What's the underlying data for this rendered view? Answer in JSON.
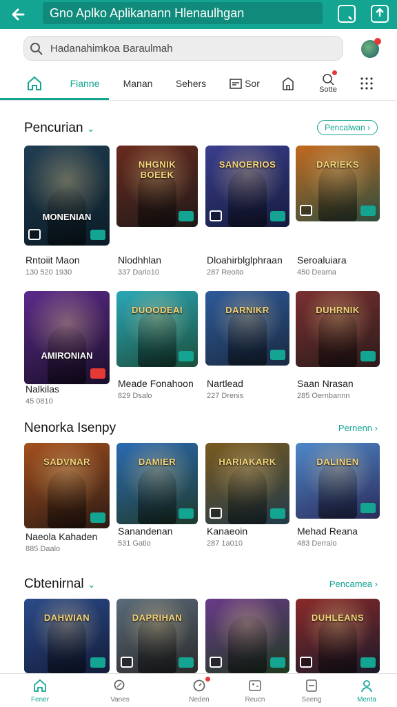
{
  "topbar": {
    "title": "Gno Aplko Aplikanann Hlenaulhgan",
    "back_icon": "arrow-left-icon",
    "icons": [
      "bookmark-icon",
      "share-icon"
    ]
  },
  "search": {
    "placeholder": "Hadanahimkoa Baraulmah"
  },
  "tabs": [
    {
      "label": ""
    },
    {
      "label": "Fianne"
    },
    {
      "label": "Manan"
    },
    {
      "label": "Sehers"
    },
    {
      "label": "Sor"
    },
    {
      "label": ""
    },
    {
      "label": "Sotte"
    },
    {
      "label": ""
    }
  ],
  "sections": [
    {
      "title": "Pencurian",
      "link": "Pencalwan"
    },
    {
      "title": "Nenorka Isenpy",
      "link": "Pernenn"
    },
    {
      "title": "Cbtenirnal",
      "link": "Pencamea"
    }
  ],
  "cards": [
    {
      "title": "Rntoiit Maon",
      "sub": "130 520 1930",
      "art": "MONENIAN",
      "colors": [
        "#1f3d52",
        "#0b1b26"
      ]
    },
    {
      "title": "Nlodhhlan",
      "sub": "337 Dario10",
      "art": "NHGNIK BOEEK",
      "colors": [
        "#6a2b1e",
        "#1f1a1a"
      ]
    },
    {
      "title": "Dloahirblglphraan",
      "sub": "287 Reoito",
      "art": "SANOERIOS",
      "colors": [
        "#3b3f8e",
        "#151b3d"
      ]
    },
    {
      "title": "Seroaluiara",
      "sub": "450 Deama",
      "art": "DARIEKS",
      "colors": [
        "#c26a1f",
        "#2e4d3f"
      ]
    },
    {
      "title": "Nalkilas",
      "sub": "45 0810",
      "art": "AMIRONIAN",
      "colors": [
        "#5b2a8a",
        "#1a0f2a"
      ]
    },
    {
      "title": "Meade Fonahoon",
      "sub": "829 Dsalo",
      "art": "DUOODEAI",
      "colors": [
        "#2aa7b8",
        "#1b4e3a"
      ]
    },
    {
      "title": "Nartlead",
      "sub": "227 Drenis",
      "art": "DARNIKR",
      "colors": [
        "#2e5b9b",
        "#1a2940"
      ]
    },
    {
      "title": "Saan Nrasan",
      "sub": "285 Oernbannn",
      "art": "DUHRNIK",
      "colors": [
        "#7a3030",
        "#2b1b1b"
      ]
    },
    {
      "title": "Naeola Kahaden",
      "sub": "885 Daalo",
      "art": "SADVNAR",
      "colors": [
        "#a5501e",
        "#2a1a14"
      ]
    },
    {
      "title": "Sanandenan",
      "sub": "531 Gatio",
      "art": "DAMIER",
      "colors": [
        "#2b6bb3",
        "#1f3a2a"
      ]
    },
    {
      "title": "Kanaeoin",
      "sub": "287 1a010",
      "art": "HARIAKARK",
      "colors": [
        "#7a5a1f",
        "#203a4a"
      ]
    },
    {
      "title": "Mehad Reana",
      "sub": "483 Derraio",
      "art": "DALINEN",
      "colors": [
        "#4f88c9",
        "#2a2a5a"
      ]
    },
    {
      "title": "",
      "sub": "",
      "art": "DAHWIAN",
      "colors": [
        "#2b4b8a",
        "#131c3a"
      ]
    },
    {
      "title": "",
      "sub": "",
      "art": "DAPRIHAN",
      "colors": [
        "#5a6b7a",
        "#2a2a2a"
      ]
    },
    {
      "title": "",
      "sub": "",
      "art": "",
      "colors": [
        "#6a3a8a",
        "#1e3a1e"
      ]
    },
    {
      "title": "",
      "sub": "",
      "art": "DUHLEANS",
      "colors": [
        "#8a2a2a",
        "#1a1a2a"
      ]
    }
  ],
  "bottom_nav": [
    {
      "label": "Fener",
      "icon": "home-icon"
    },
    {
      "label": "Vanes",
      "icon": "search-icon"
    },
    {
      "label": "Neden",
      "icon": "bell-icon"
    },
    {
      "label": "Reucn",
      "icon": "gamepad-icon"
    },
    {
      "label": "Seeng",
      "icon": "library-icon"
    },
    {
      "label": "Menta",
      "icon": "profile-icon"
    }
  ],
  "colors": {
    "accent": "#13a592",
    "alert": "#e53935"
  }
}
